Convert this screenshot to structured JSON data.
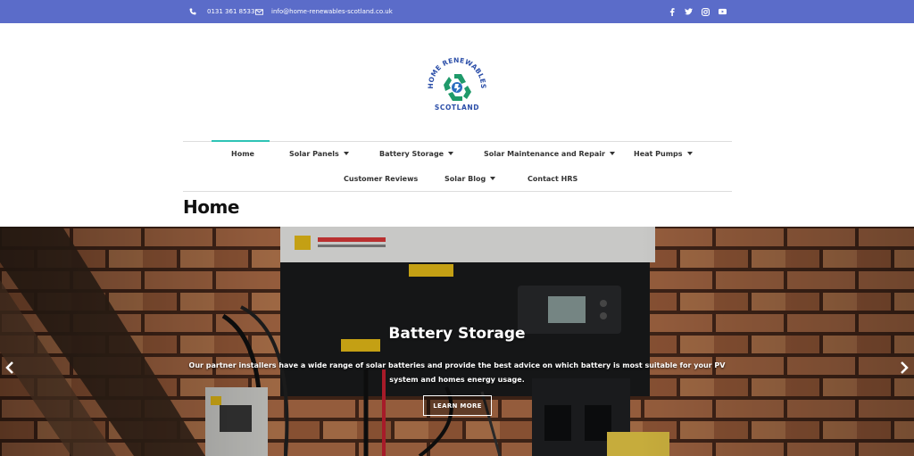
{
  "topbar": {
    "phone": "0131 361 8533",
    "email": "info@home-renewables-scotland.co.uk",
    "phone_icon": "phone-icon",
    "email_icon": "envelope-icon",
    "social": [
      "facebook-icon",
      "twitter-icon",
      "instagram-icon",
      "youtube-icon"
    ],
    "bg_color": "#5b6cc9"
  },
  "logo": {
    "arc_text": "HOME RENEWABLES",
    "bottom_text": "SCOTLAND"
  },
  "nav": {
    "row1": [
      {
        "label": "Home",
        "active": true
      },
      {
        "label": "Solar Panels",
        "dropdown": true
      },
      {
        "label": "Battery Storage",
        "dropdown": true
      },
      {
        "label": "Solar Maintenance and Repair",
        "dropdown": true
      },
      {
        "label": "Heat Pumps",
        "dropdown": true
      }
    ],
    "row2": [
      {
        "label": "Customer Reviews"
      },
      {
        "label": "Solar Blog",
        "dropdown": true
      },
      {
        "label": "Contact HRS"
      }
    ],
    "accent_color": "#2ec4b6"
  },
  "page": {
    "title": "Home"
  },
  "hero": {
    "title": "Battery Storage",
    "text": "Our partner installers have a wide range of solar batteries and provide the best advice on which battery is most suitable for your PV system and homes energy usage.",
    "button": "LEARN MORE",
    "prev_icon": "chevron-left-icon",
    "next_icon": "chevron-right-icon"
  }
}
